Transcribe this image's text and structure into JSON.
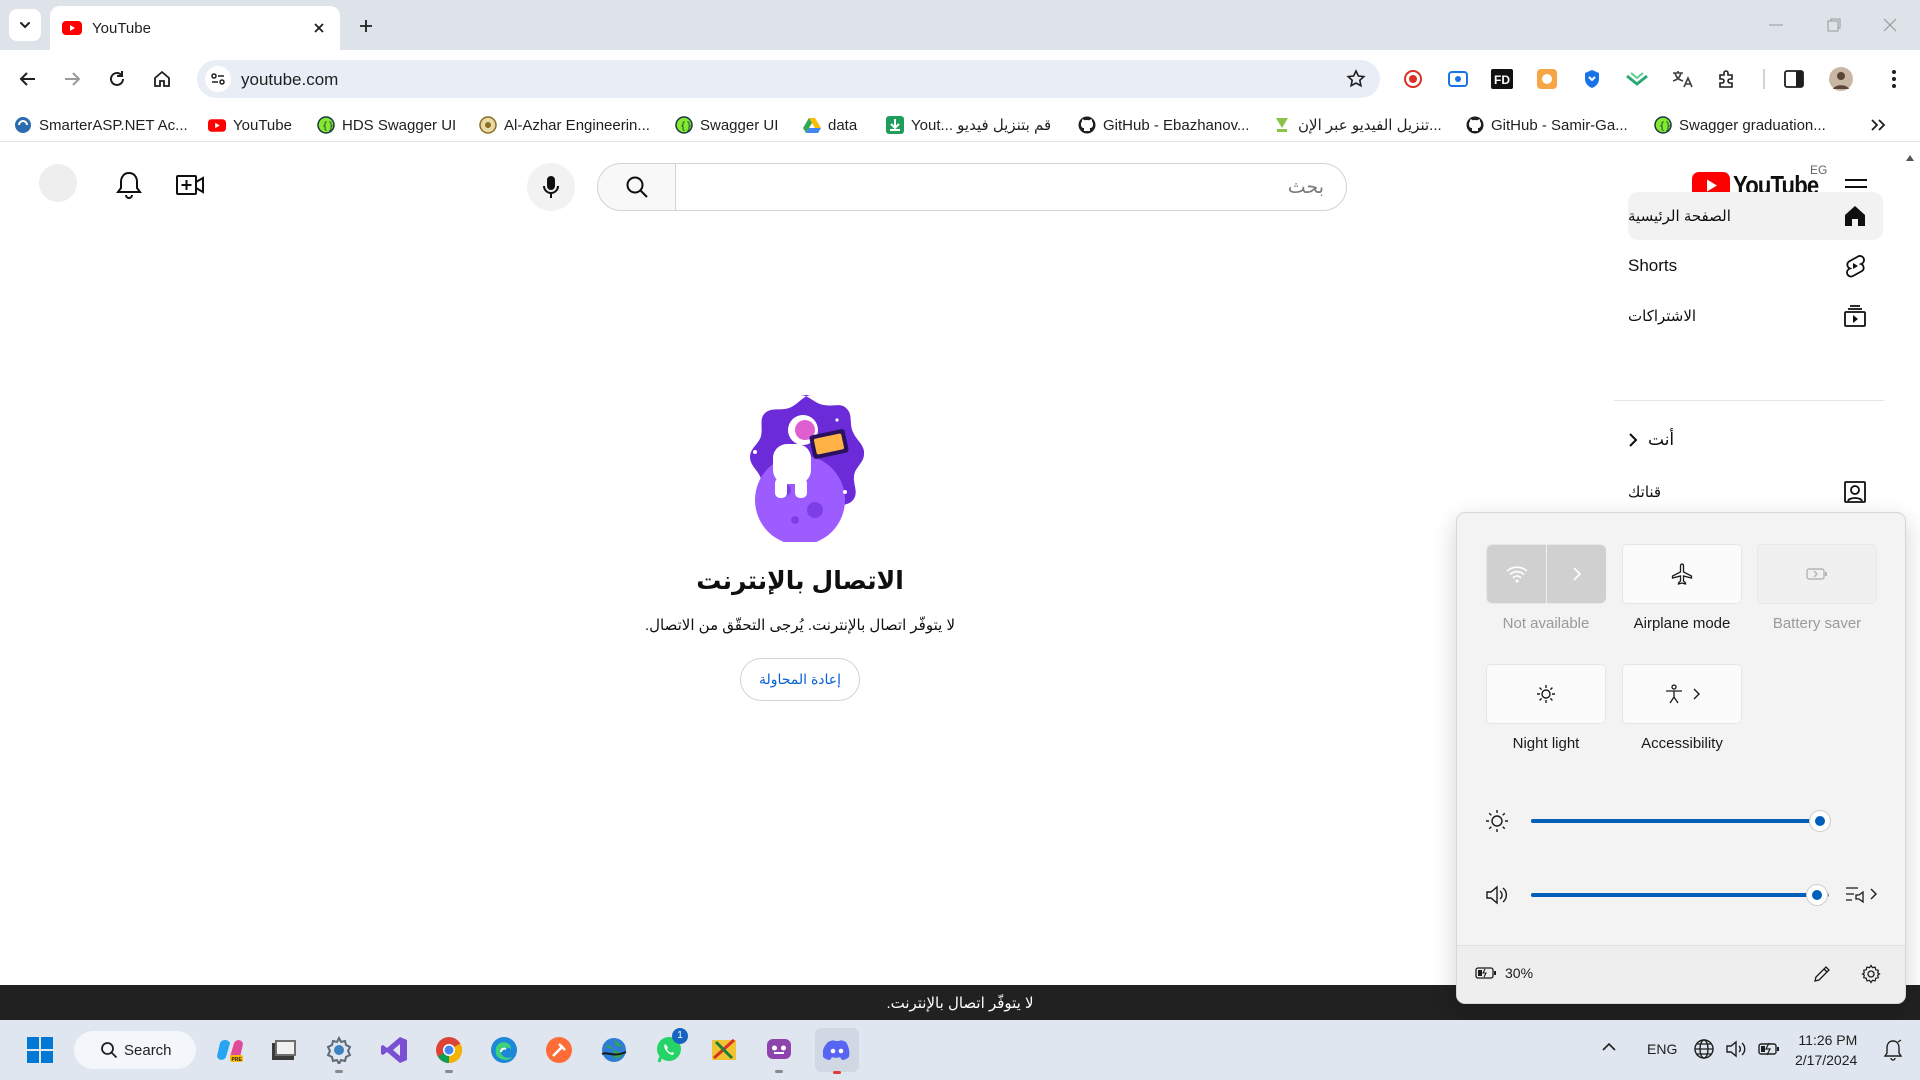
{
  "browser": {
    "tab_title": "YouTube",
    "url": "youtube.com",
    "bookmarks": [
      {
        "label": "SmarterASP.NET Ac...",
        "icon": "smarterasp-icon"
      },
      {
        "label": "YouTube",
        "icon": "youtube-icon"
      },
      {
        "label": "HDS Swagger UI",
        "icon": "swagger-icon"
      },
      {
        "label": "Al-Azhar Engineerin...",
        "icon": "azhar-icon"
      },
      {
        "label": "Swagger UI",
        "icon": "swagger-icon"
      },
      {
        "label": "data",
        "icon": "google-drive-icon"
      },
      {
        "label": "Yout... قم بتنزيل فيديو",
        "icon": "download-icon"
      },
      {
        "label": "GitHub - Ebazhanov...",
        "icon": "github-icon"
      },
      {
        "label": "تنزيل الفيديو عبر الإن...",
        "icon": "android-download-icon"
      },
      {
        "label": "GitHub - Samir-Ga...",
        "icon": "github-icon"
      },
      {
        "label": "Swagger graduation...",
        "icon": "swagger-icon"
      }
    ]
  },
  "youtube": {
    "search_placeholder": "بحث",
    "logo_text": "YouTube",
    "country_code": "EG",
    "sidebar": {
      "home": "الصفحة الرئيسية",
      "shorts": "Shorts",
      "subscriptions": "الاشتراكات",
      "you": "أنت",
      "your_channel": "قناتك"
    },
    "offline": {
      "title": "الاتصال بالإنترنت",
      "message": "لا يتوفّر اتصال بالإنترنت. يُرجى التحقّق من الاتصال.",
      "retry": "إعادة المحاولة"
    },
    "status_bar": "لا يتوفّر اتصال بالإنترنت."
  },
  "quick_settings": {
    "tiles": [
      {
        "label": "Not available",
        "icon": "wifi-icon",
        "disabled": true
      },
      {
        "label": "Airplane mode",
        "icon": "airplane-icon",
        "disabled": false
      },
      {
        "label": "Battery saver",
        "icon": "battery-saver-icon",
        "disabled": true
      },
      {
        "label": "Night light",
        "icon": "night-light-icon",
        "disabled": false
      },
      {
        "label": "Accessibility",
        "icon": "accessibility-icon",
        "disabled": false
      }
    ],
    "brightness": 0.97,
    "volume": 0.96,
    "battery": "30%",
    "accent_color": "#005fb8"
  },
  "taskbar": {
    "search_label": "Search",
    "language": "ENG",
    "time": "11:26 PM",
    "date": "2/17/2024",
    "whatsapp_badge": "1"
  }
}
